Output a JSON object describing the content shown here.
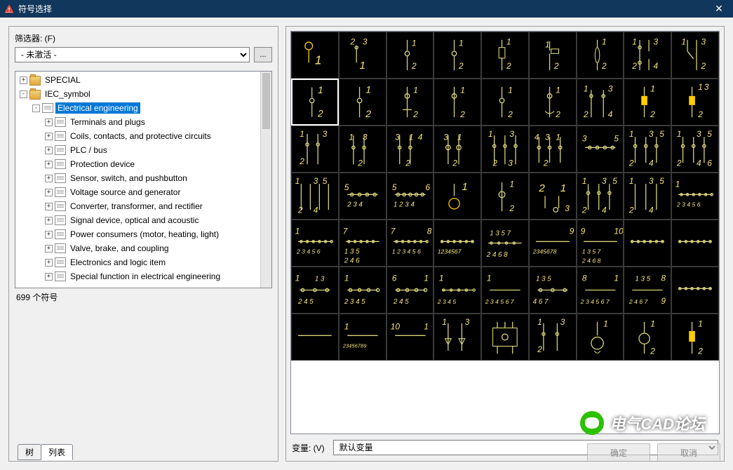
{
  "titlebar": {
    "title": "符号选择"
  },
  "filter": {
    "label": "筛选器: (F)",
    "value": "- 未激活 -",
    "more": "..."
  },
  "tree": {
    "items": [
      {
        "level": 0,
        "exp": "+",
        "icon": "folder",
        "label": "SPECIAL"
      },
      {
        "level": 0,
        "exp": "-",
        "icon": "folder",
        "label": "IEC_symbol"
      },
      {
        "level": 1,
        "exp": "-",
        "icon": "doc",
        "label": "Electrical engineering",
        "selected": true
      },
      {
        "level": 2,
        "exp": "+",
        "icon": "doc",
        "label": "Terminals and plugs"
      },
      {
        "level": 2,
        "exp": "+",
        "icon": "doc",
        "label": "Coils, contacts, and protective circuits"
      },
      {
        "level": 2,
        "exp": "+",
        "icon": "doc",
        "label": "PLC / bus"
      },
      {
        "level": 2,
        "exp": "+",
        "icon": "doc",
        "label": "Protection device"
      },
      {
        "level": 2,
        "exp": "+",
        "icon": "doc",
        "label": "Sensor, switch, and pushbutton"
      },
      {
        "level": 2,
        "exp": "+",
        "icon": "doc",
        "label": "Voltage source and generator"
      },
      {
        "level": 2,
        "exp": "+",
        "icon": "doc",
        "label": "Converter, transformer, and rectifier"
      },
      {
        "level": 2,
        "exp": "+",
        "icon": "doc",
        "label": "Signal device, optical and acoustic"
      },
      {
        "level": 2,
        "exp": "+",
        "icon": "doc",
        "label": "Power consumers (motor, heating, light)"
      },
      {
        "level": 2,
        "exp": "+",
        "icon": "doc",
        "label": "Valve, brake, and coupling"
      },
      {
        "level": 2,
        "exp": "+",
        "icon": "doc",
        "label": "Electronics and logic item"
      },
      {
        "level": 2,
        "exp": "+",
        "icon": "doc",
        "label": "Special function in electrical engineering"
      }
    ]
  },
  "status": {
    "count": "699 个符号"
  },
  "tabs": {
    "tree": "树",
    "list": "列表"
  },
  "variant": {
    "label": "变量: (V)",
    "value": "默认变量"
  },
  "buttons": {
    "ok": "确定",
    "cancel": "取消"
  },
  "watermark": {
    "text": "电气CAD论坛"
  },
  "symbols": {
    "count": 63
  }
}
